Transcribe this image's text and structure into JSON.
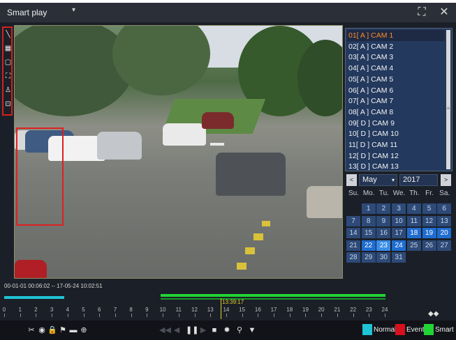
{
  "window": {
    "title": "Smart play",
    "title_caret": "▾",
    "fullscreen_icon": "fullscreen-icon",
    "close_icon": "close-icon"
  },
  "tools": [
    {
      "name": "draw-line-tool",
      "glyph": "╲"
    },
    {
      "name": "grid-tool",
      "glyph": "▦"
    },
    {
      "name": "region-tool",
      "glyph": "▢"
    },
    {
      "name": "expand-tool",
      "glyph": "⛶"
    },
    {
      "name": "person-tool",
      "glyph": "♙"
    },
    {
      "name": "face-tool",
      "glyph": "⊡"
    }
  ],
  "cameras": [
    "01[ A ] CAM 1",
    "02[ A ] CAM 2",
    "03[ A ] CAM 3",
    "04[ A ] CAM 4",
    "05[ A ] CAM 5",
    "06[ A ] CAM 6",
    "07[ A ] CAM 7",
    "08[ A ] CAM 8",
    "09[ D ] CAM 9",
    "10[ D ] CAM 10",
    "11[ D ] CAM 11",
    "12[ D ] CAM 12",
    "13[ D ] CAM 13"
  ],
  "selected_camera_index": 0,
  "calendar": {
    "prev_label": "<",
    "next_label": ">",
    "month": "May",
    "year": "2017",
    "weekdays": [
      "Su.",
      "Mo.",
      "Tu.",
      "We.",
      "Th.",
      "Fr.",
      "Sa."
    ],
    "first_weekday_offset": 1,
    "days_in_month": 31,
    "days_with_records": [
      18,
      19,
      20,
      22,
      24
    ],
    "selected_day": 23
  },
  "timeline": {
    "range_text": "00-01-01 00:06:02 -- 17-05-24 10:02:51",
    "cursor_time": "13:39:17",
    "hour_labels": [
      "0",
      "1",
      "2",
      "3",
      "4",
      "5",
      "6",
      "7",
      "8",
      "9",
      "10",
      "11",
      "12",
      "13",
      "14",
      "15",
      "16",
      "17",
      "18",
      "19",
      "20",
      "21",
      "22",
      "23",
      "24"
    ],
    "zoom_label": "◆◆",
    "colors": {
      "normal": "#1fc3d6",
      "event": "#d6101c",
      "smart": "#21d436"
    }
  },
  "toolbar": {
    "left_buttons": [
      {
        "name": "clip-icon",
        "glyph": "✂"
      },
      {
        "name": "snapshot-icon",
        "glyph": "◉"
      },
      {
        "name": "lock-icon",
        "glyph": "🔒"
      },
      {
        "name": "tag-icon",
        "glyph": "⚑"
      },
      {
        "name": "folder-icon",
        "glyph": "▬"
      },
      {
        "name": "zoom-icon",
        "glyph": "⊕"
      }
    ],
    "center_buttons": [
      {
        "name": "rewind-icon",
        "glyph": "◀◀",
        "dim": true
      },
      {
        "name": "reverse-play-icon",
        "glyph": "◀",
        "dim": true
      },
      {
        "name": "pause-icon",
        "glyph": "❚❚",
        "dim": false
      },
      {
        "name": "step-icon",
        "glyph": "▶",
        "dim": true
      },
      {
        "name": "stop-icon",
        "glyph": "■",
        "dim": false
      },
      {
        "name": "settings-icon",
        "glyph": "✹",
        "dim": false
      },
      {
        "name": "search-icon",
        "glyph": "⚲",
        "dim": false
      },
      {
        "name": "filter-icon",
        "glyph": "▼",
        "dim": false
      }
    ],
    "legend": [
      {
        "label": "Normal",
        "color": "#1fc3d6"
      },
      {
        "label": "Event",
        "color": "#d6101c"
      },
      {
        "label": "Smart",
        "color": "#21d436"
      }
    ]
  }
}
